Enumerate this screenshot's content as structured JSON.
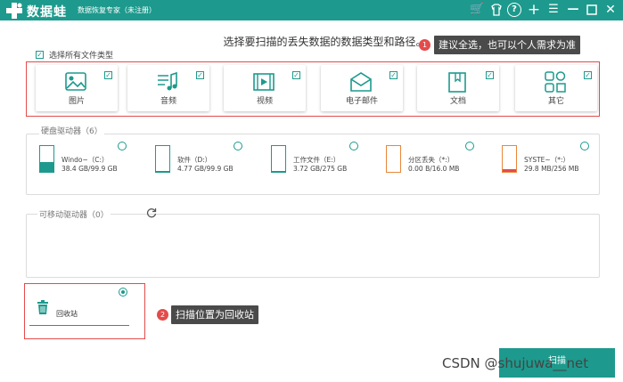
{
  "titlebar": {
    "app_name": "数据蛙",
    "app_subtitle": "数据恢复专家（未注册）",
    "icons": [
      "cart-icon",
      "skin-icon",
      "help-icon",
      "plus-icon",
      "menu-icon",
      "minimize-icon",
      "close-icon"
    ]
  },
  "headline": "选择要扫描的丢失数据的数据类型和路径。",
  "select_all": {
    "label": "选择所有文件类型",
    "checked": true
  },
  "file_types": [
    {
      "label": "图片",
      "checked": true,
      "icon": "image-icon"
    },
    {
      "label": "音频",
      "checked": true,
      "icon": "audio-icon"
    },
    {
      "label": "视频",
      "checked": true,
      "icon": "video-icon"
    },
    {
      "label": "电子邮件",
      "checked": true,
      "icon": "email-icon"
    },
    {
      "label": "文档",
      "checked": true,
      "icon": "document-icon"
    },
    {
      "label": "其它",
      "checked": true,
      "icon": "other-icon"
    }
  ],
  "hard_drives": {
    "title": "硬盘驱动器（6）",
    "items": [
      {
        "name": "Windo~（C:）",
        "size": "38.4 GB/99.9 GB",
        "usage": 0.38,
        "color": "#1d9a8d"
      },
      {
        "name": "软件（D:）",
        "size": "4.77 GB/99.9 GB",
        "usage": 0.05,
        "color": "#1d9a8d"
      },
      {
        "name": "工作文件（E:）",
        "size": "3.72 GB/275 GB",
        "usage": 0.01,
        "color": "#1d9a8d"
      },
      {
        "name": "分区丢失（*:）",
        "size": "0.00  B/16.0 MB",
        "usage": 0.0,
        "color": "#e8873a"
      },
      {
        "name": "SYSTE~（*:）",
        "size": "29.8 MB/256 MB",
        "usage": 0.12,
        "color": "#e8873a"
      }
    ]
  },
  "removable": {
    "title": "可移动驱动器（0）",
    "refresh_icon": "refresh-icon"
  },
  "recycle_bin": {
    "label": "回收站",
    "selected": true,
    "icon": "trash-icon"
  },
  "tooltips": [
    {
      "num": "1",
      "text": "建议全选，也可以个人需求为准"
    },
    {
      "num": "2",
      "text": "扫描位置为回收站"
    }
  ],
  "scan_button": "扫描",
  "watermark": "CSDN @shujuwa__net",
  "colors": {
    "accent": "#1d9a8d",
    "highlight": "#e44b4b",
    "warning": "#e8873a"
  }
}
